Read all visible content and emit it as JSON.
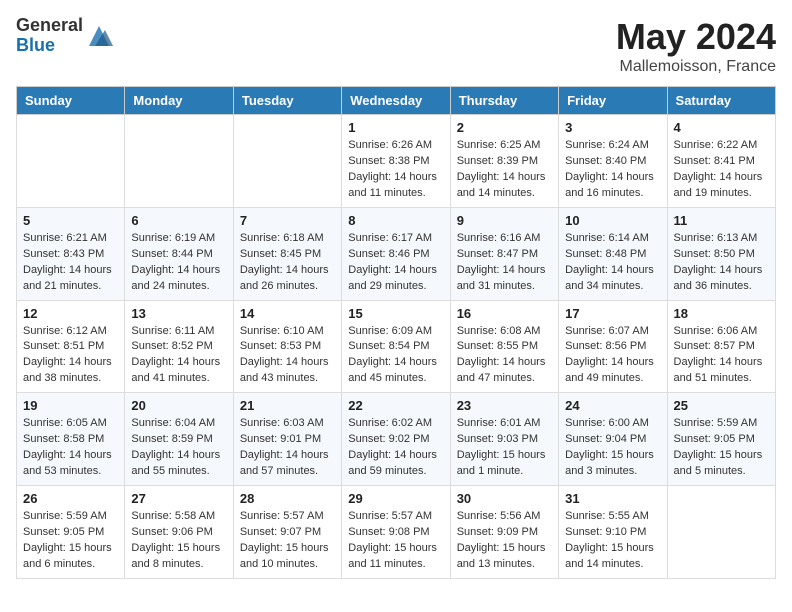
{
  "header": {
    "logo_general": "General",
    "logo_blue": "Blue",
    "month": "May 2024",
    "location": "Mallemoisson, France"
  },
  "weekdays": [
    "Sunday",
    "Monday",
    "Tuesday",
    "Wednesday",
    "Thursday",
    "Friday",
    "Saturday"
  ],
  "weeks": [
    [
      {
        "day": "",
        "info": ""
      },
      {
        "day": "",
        "info": ""
      },
      {
        "day": "",
        "info": ""
      },
      {
        "day": "1",
        "info": "Sunrise: 6:26 AM\nSunset: 8:38 PM\nDaylight: 14 hours\nand 11 minutes."
      },
      {
        "day": "2",
        "info": "Sunrise: 6:25 AM\nSunset: 8:39 PM\nDaylight: 14 hours\nand 14 minutes."
      },
      {
        "day": "3",
        "info": "Sunrise: 6:24 AM\nSunset: 8:40 PM\nDaylight: 14 hours\nand 16 minutes."
      },
      {
        "day": "4",
        "info": "Sunrise: 6:22 AM\nSunset: 8:41 PM\nDaylight: 14 hours\nand 19 minutes."
      }
    ],
    [
      {
        "day": "5",
        "info": "Sunrise: 6:21 AM\nSunset: 8:43 PM\nDaylight: 14 hours\nand 21 minutes."
      },
      {
        "day": "6",
        "info": "Sunrise: 6:19 AM\nSunset: 8:44 PM\nDaylight: 14 hours\nand 24 minutes."
      },
      {
        "day": "7",
        "info": "Sunrise: 6:18 AM\nSunset: 8:45 PM\nDaylight: 14 hours\nand 26 minutes."
      },
      {
        "day": "8",
        "info": "Sunrise: 6:17 AM\nSunset: 8:46 PM\nDaylight: 14 hours\nand 29 minutes."
      },
      {
        "day": "9",
        "info": "Sunrise: 6:16 AM\nSunset: 8:47 PM\nDaylight: 14 hours\nand 31 minutes."
      },
      {
        "day": "10",
        "info": "Sunrise: 6:14 AM\nSunset: 8:48 PM\nDaylight: 14 hours\nand 34 minutes."
      },
      {
        "day": "11",
        "info": "Sunrise: 6:13 AM\nSunset: 8:50 PM\nDaylight: 14 hours\nand 36 minutes."
      }
    ],
    [
      {
        "day": "12",
        "info": "Sunrise: 6:12 AM\nSunset: 8:51 PM\nDaylight: 14 hours\nand 38 minutes."
      },
      {
        "day": "13",
        "info": "Sunrise: 6:11 AM\nSunset: 8:52 PM\nDaylight: 14 hours\nand 41 minutes."
      },
      {
        "day": "14",
        "info": "Sunrise: 6:10 AM\nSunset: 8:53 PM\nDaylight: 14 hours\nand 43 minutes."
      },
      {
        "day": "15",
        "info": "Sunrise: 6:09 AM\nSunset: 8:54 PM\nDaylight: 14 hours\nand 45 minutes."
      },
      {
        "day": "16",
        "info": "Sunrise: 6:08 AM\nSunset: 8:55 PM\nDaylight: 14 hours\nand 47 minutes."
      },
      {
        "day": "17",
        "info": "Sunrise: 6:07 AM\nSunset: 8:56 PM\nDaylight: 14 hours\nand 49 minutes."
      },
      {
        "day": "18",
        "info": "Sunrise: 6:06 AM\nSunset: 8:57 PM\nDaylight: 14 hours\nand 51 minutes."
      }
    ],
    [
      {
        "day": "19",
        "info": "Sunrise: 6:05 AM\nSunset: 8:58 PM\nDaylight: 14 hours\nand 53 minutes."
      },
      {
        "day": "20",
        "info": "Sunrise: 6:04 AM\nSunset: 8:59 PM\nDaylight: 14 hours\nand 55 minutes."
      },
      {
        "day": "21",
        "info": "Sunrise: 6:03 AM\nSunset: 9:01 PM\nDaylight: 14 hours\nand 57 minutes."
      },
      {
        "day": "22",
        "info": "Sunrise: 6:02 AM\nSunset: 9:02 PM\nDaylight: 14 hours\nand 59 minutes."
      },
      {
        "day": "23",
        "info": "Sunrise: 6:01 AM\nSunset: 9:03 PM\nDaylight: 15 hours\nand 1 minute."
      },
      {
        "day": "24",
        "info": "Sunrise: 6:00 AM\nSunset: 9:04 PM\nDaylight: 15 hours\nand 3 minutes."
      },
      {
        "day": "25",
        "info": "Sunrise: 5:59 AM\nSunset: 9:05 PM\nDaylight: 15 hours\nand 5 minutes."
      }
    ],
    [
      {
        "day": "26",
        "info": "Sunrise: 5:59 AM\nSunset: 9:05 PM\nDaylight: 15 hours\nand 6 minutes."
      },
      {
        "day": "27",
        "info": "Sunrise: 5:58 AM\nSunset: 9:06 PM\nDaylight: 15 hours\nand 8 minutes."
      },
      {
        "day": "28",
        "info": "Sunrise: 5:57 AM\nSunset: 9:07 PM\nDaylight: 15 hours\nand 10 minutes."
      },
      {
        "day": "29",
        "info": "Sunrise: 5:57 AM\nSunset: 9:08 PM\nDaylight: 15 hours\nand 11 minutes."
      },
      {
        "day": "30",
        "info": "Sunrise: 5:56 AM\nSunset: 9:09 PM\nDaylight: 15 hours\nand 13 minutes."
      },
      {
        "day": "31",
        "info": "Sunrise: 5:55 AM\nSunset: 9:10 PM\nDaylight: 15 hours\nand 14 minutes."
      },
      {
        "day": "",
        "info": ""
      }
    ]
  ]
}
